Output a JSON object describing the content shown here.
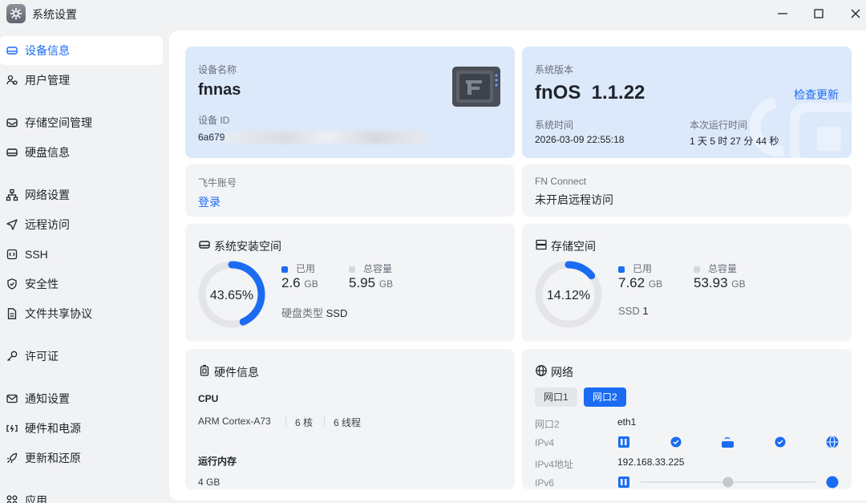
{
  "app": {
    "title": "系统设置"
  },
  "sidebar": {
    "items": [
      {
        "label": "设备信息",
        "icon": "device-icon"
      },
      {
        "label": "用户管理",
        "icon": "users-icon"
      },
      {
        "label": "存储空间管理",
        "icon": "storage-icon"
      },
      {
        "label": "硬盘信息",
        "icon": "disk-icon"
      },
      {
        "label": "网络设置",
        "icon": "network-icon"
      },
      {
        "label": "远程访问",
        "icon": "send-icon"
      },
      {
        "label": "SSH",
        "icon": "ssh-icon"
      },
      {
        "label": "安全性",
        "icon": "shield-icon"
      },
      {
        "label": "文件共享协议",
        "icon": "file-icon"
      },
      {
        "label": "许可证",
        "icon": "key-icon"
      },
      {
        "label": "通知设置",
        "icon": "mail-icon"
      },
      {
        "label": "硬件和电源",
        "icon": "power-icon"
      },
      {
        "label": "更新和还原",
        "icon": "rocket-icon"
      },
      {
        "label": "应用",
        "icon": "apps-icon"
      }
    ]
  },
  "device": {
    "name_label": "设备名称",
    "name": "fnnas",
    "id_label": "设备 ID",
    "id_prefix": "6a679"
  },
  "system": {
    "version_label": "系统版本",
    "version": "fnOS  1.1.22",
    "check_update": "检查更新",
    "time_label": "系统时间",
    "time": "2026-03-09 22:55:18",
    "uptime_label": "本次运行时间",
    "uptime": "1 天 5 时 27 分 44 秒"
  },
  "account": {
    "label": "飞牛账号",
    "login": "登录"
  },
  "fn_connect": {
    "label": "FN Connect",
    "status": "未开启远程访问"
  },
  "sys_space": {
    "title": "系统安装空间",
    "percent": "43.65%",
    "fraction": 0.4365,
    "used_label": "已用",
    "used": "2.6",
    "used_unit": "GB",
    "total_label": "总容量",
    "total": "5.95",
    "total_unit": "GB",
    "disk_type_label": "硬盘类型",
    "disk_type": "SSD"
  },
  "storage": {
    "title": "存储空间",
    "percent": "14.12%",
    "fraction": 0.1412,
    "used_label": "已用",
    "used": "7.62",
    "used_unit": "GB",
    "total_label": "总容量",
    "total": "53.93",
    "total_unit": "GB",
    "ssd_label": "SSD",
    "ssd_count": "1"
  },
  "hardware": {
    "title": "硬件信息",
    "cpu_label": "CPU",
    "cpu_model": "ARM Cortex-A73",
    "cores": "6 核",
    "threads": "6 线程",
    "ram_label": "运行内存",
    "ram": "4 GB"
  },
  "network": {
    "title": "网络",
    "tabs": [
      "网口1",
      "网口2"
    ],
    "port_label": "网口2",
    "port_value": "eth1",
    "ipv4_label": "IPv4",
    "ipv4_addr_label": "IPv4地址",
    "ipv4_addr": "192.168.33.225",
    "ipv6_label": "IPv6"
  },
  "colors": {
    "accent": "#1b6cf2",
    "ring_track": "#e3e5e8"
  }
}
